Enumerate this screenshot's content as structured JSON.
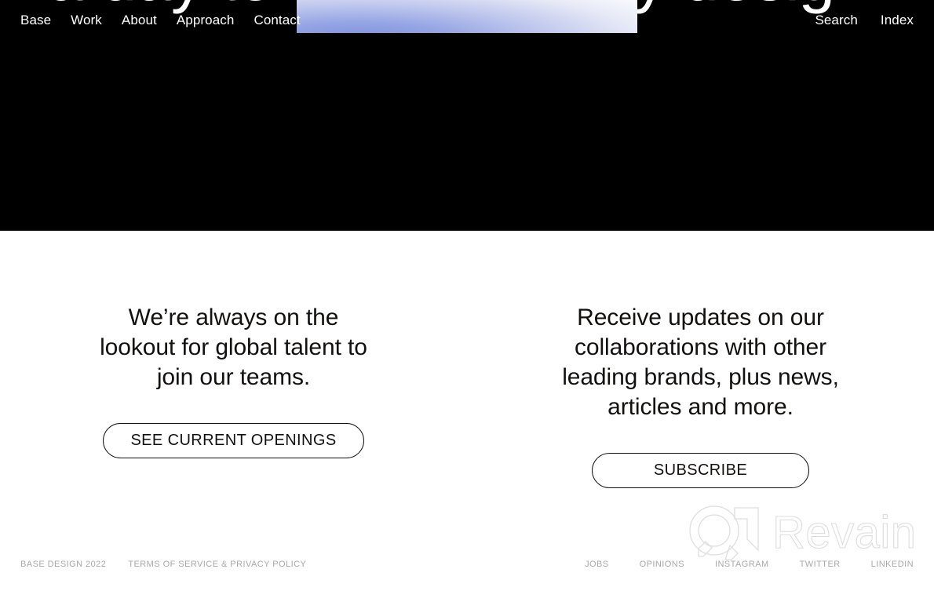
{
  "hero": {
    "headline_partial": "a day to remember by design.",
    "background_color": "#000000",
    "gradient_panel": {
      "name": "hero-gradient-image",
      "from_color": "#7e91de",
      "to_color": "#ffffff"
    }
  },
  "nav": {
    "left_items": [
      {
        "label": "Base"
      },
      {
        "label": "Work"
      },
      {
        "label": "About"
      },
      {
        "label": "Approach"
      },
      {
        "label": "Contact"
      }
    ],
    "right_items": [
      {
        "label": "Search"
      },
      {
        "label": "Index"
      }
    ]
  },
  "cta": {
    "left": {
      "text": "We’re always on the lookout for global talent to join our teams.",
      "button_label": "SEE CURRENT OPENINGS"
    },
    "right": {
      "text": "Receive updates on our collaborations with other leading brands, plus news, articles and more.",
      "button_label": "SUBSCRIBE"
    }
  },
  "footer": {
    "left_items": [
      {
        "label": "BASE DESIGN 2022"
      },
      {
        "label": "TERMS OF SERVICE & PRIVACY POLICY"
      }
    ],
    "right_items": [
      {
        "label": "JOBS"
      },
      {
        "label": "OPINIONS"
      },
      {
        "label": "INSTAGRAM"
      },
      {
        "label": "TWITTER"
      },
      {
        "label": "LINKEDIN"
      }
    ],
    "text_color": "#a9a9a9"
  },
  "watermark": {
    "text": "Revain",
    "stroke_color": "#dddddd"
  }
}
